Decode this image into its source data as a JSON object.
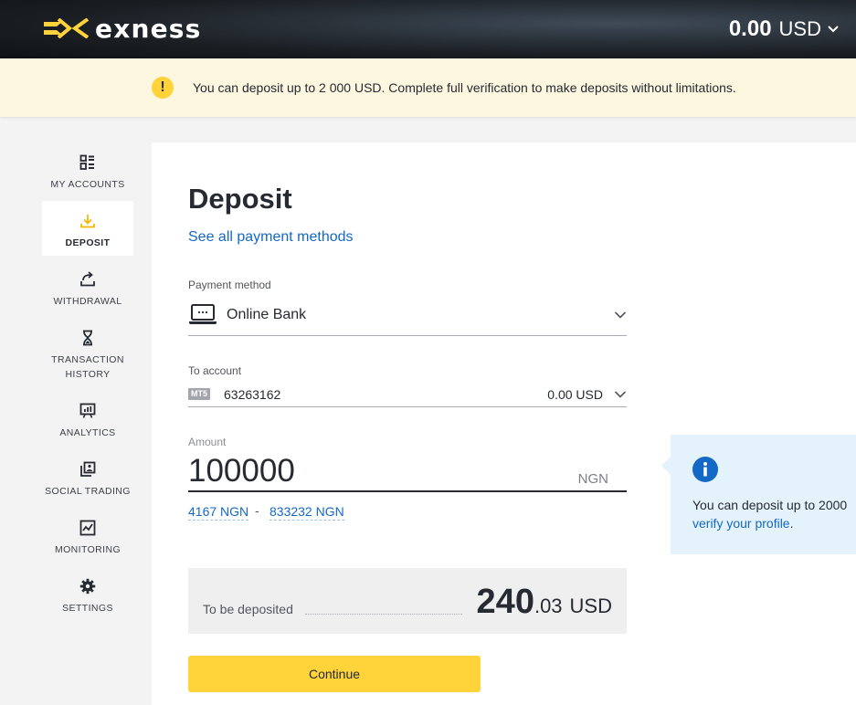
{
  "header": {
    "logo_text": "exness",
    "balance_amount": "0.00",
    "balance_currency": "USD"
  },
  "banner": {
    "text": "You can deposit up to 2 000 USD. Complete full verification to make deposits without limitations."
  },
  "sidebar": {
    "items": [
      {
        "label": "MY ACCOUNTS",
        "icon": "accounts-grid-icon"
      },
      {
        "label": "DEPOSIT",
        "icon": "download-icon",
        "active": true
      },
      {
        "label": "WITHDRAWAL",
        "icon": "upload-icon"
      },
      {
        "label": "TRANSACTION",
        "label2": "HISTORY",
        "icon": "hourglass-icon"
      },
      {
        "label": "ANALYTICS",
        "icon": "chart-board-icon"
      },
      {
        "label": "SOCIAL TRADING",
        "icon": "social-trading-icon"
      },
      {
        "label": "MONITORING",
        "icon": "monitoring-icon"
      },
      {
        "label": "SETTINGS",
        "icon": "gear-icon"
      }
    ]
  },
  "main": {
    "title": "Deposit",
    "see_all_link": "See all payment methods",
    "payment_method": {
      "label": "Payment method",
      "value": "Online Bank"
    },
    "to_account": {
      "label": "To account",
      "badge": "MT5",
      "number": "63263162",
      "balance": "0.00 USD"
    },
    "amount": {
      "label": "Amount",
      "value": "100000",
      "currency": "NGN",
      "min": "4167 NGN",
      "separator": "-",
      "max": "833232 NGN"
    },
    "to_be_deposited": {
      "label": "To be deposited",
      "integer": "240",
      "decimal": ".03",
      "currency": "USD"
    },
    "continue_label": "Continue"
  },
  "tip": {
    "text": "You can deposit up to 2000",
    "link": "verify your profile",
    "suffix": "."
  },
  "colors": {
    "accent_yellow": "#ffd339",
    "link_blue": "#1468c6",
    "banner_bg": "#fdf7df",
    "tip_bg": "#e4f2fb"
  }
}
